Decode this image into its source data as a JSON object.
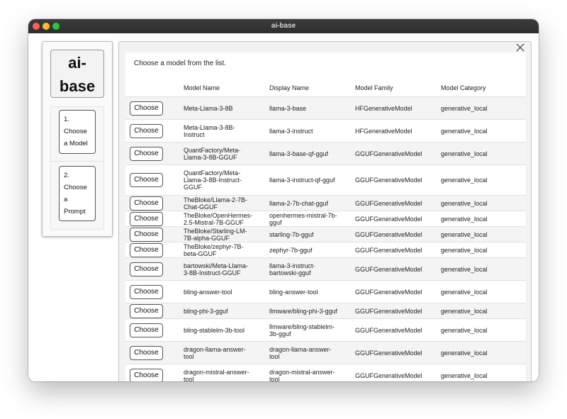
{
  "window": {
    "title": "ai-base"
  },
  "sidebar": {
    "logo_line1": "ai-",
    "logo_line2": "base",
    "steps": [
      {
        "lines": [
          "1.",
          "Choose",
          "a Model"
        ]
      },
      {
        "lines": [
          "2.",
          "Choose",
          "a",
          "Prompt"
        ]
      }
    ]
  },
  "panel": {
    "prompt": "Choose a model from the list.",
    "choose_label": "Choose",
    "columns": [
      "Model Name",
      "Display Name",
      "Model Family",
      "Model Category"
    ],
    "rows": [
      {
        "name": [
          "Meta-Llama-3-8B"
        ],
        "display": [
          "llama-3-base"
        ],
        "family": "HFGenerativeModel",
        "category": "generative_local"
      },
      {
        "name": [
          "Meta-Llama-3-8B-",
          "Instruct"
        ],
        "display": [
          "llama-3-instruct"
        ],
        "family": "HFGenerativeModel",
        "category": "generative_local"
      },
      {
        "name": [
          "QuantFactory/Meta-",
          "Llama-3-8B-GGUF"
        ],
        "display": [
          "llama-3-base-qf-gguf"
        ],
        "family": "GGUFGenerativeModel",
        "category": "generative_local"
      },
      {
        "name": [
          "QuantFactory/Meta-",
          "Llama-3-8B-Instruct-",
          "GGUF"
        ],
        "display": [
          "llama-3-instruct-qf-gguf"
        ],
        "family": "GGUFGenerativeModel",
        "category": "generative_local"
      },
      {
        "name": [
          "TheBloke/Llama-2-7B-",
          "Chat-GGUF"
        ],
        "display": [
          "llama-2-7b-chat-gguf"
        ],
        "family": "GGUFGenerativeModel",
        "category": "generative_local"
      },
      {
        "name": [
          "TheBloke/OpenHermes-",
          "2.5-Mistral-7B-GGUF"
        ],
        "display": [
          "openhermes-mistral-7b-",
          "gguf"
        ],
        "family": "GGUFGenerativeModel",
        "category": "generative_local"
      },
      {
        "name": [
          "TheBloke/Starling-LM-",
          "7B-alpha-GGUF"
        ],
        "display": [
          "starling-7b-gguf"
        ],
        "family": "GGUFGenerativeModel",
        "category": "generative_local"
      },
      {
        "name": [
          "TheBloke/zephyr-7B-",
          "beta-GGUF"
        ],
        "display": [
          "zephyr-7b-gguf"
        ],
        "family": "GGUFGenerativeModel",
        "category": "generative_local"
      },
      {
        "name": [
          "bartowski/Meta-Llama-",
          "3-8B-Instruct-GGUF"
        ],
        "display": [
          "llama-3-instruct-",
          "bartowski-gguf"
        ],
        "family": "GGUFGenerativeModel",
        "category": "generative_local"
      },
      {
        "name": [
          "bling-answer-tool"
        ],
        "display": [
          "bling-answer-tool"
        ],
        "family": "GGUFGenerativeModel",
        "category": "generative_local"
      },
      {
        "name": [
          "bling-phi-3-gguf"
        ],
        "display": [
          "llmware/bling-phi-3-gguf"
        ],
        "family": "GGUFGenerativeModel",
        "category": "generative_local"
      },
      {
        "name": [
          "bling-stablelm-3b-tool"
        ],
        "display": [
          "llmware/bling-stablelm-",
          "3b-gguf"
        ],
        "family": "GGUFGenerativeModel",
        "category": "generative_local"
      },
      {
        "name": [
          "dragon-llama-answer-",
          "tool"
        ],
        "display": [
          "dragon-llama-answer-",
          "tool"
        ],
        "family": "GGUFGenerativeModel",
        "category": "generative_local"
      },
      {
        "name": [
          "dragon-mistral-answer-",
          "tool"
        ],
        "display": [
          "dragon-mistral-answer-",
          "tool"
        ],
        "family": "GGUFGenerativeModel",
        "category": "generative_local"
      }
    ]
  }
}
